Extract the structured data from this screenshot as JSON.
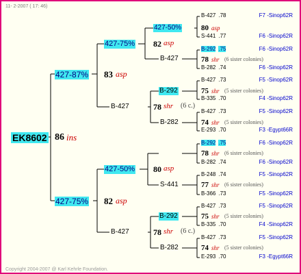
{
  "header": {
    "text": "11- 2-2007 ( 17: 46)"
  },
  "footer": {
    "text": "Copyright 2004-2007 @ Karl Kehrle Foundation."
  },
  "colors": {
    "border": "#e0007a",
    "highlight": "#40e8f0",
    "link": "#0000cc",
    "race": "#cc0000"
  },
  "root": {
    "id": "EK8602",
    "number": "86",
    "race": "ins"
  },
  "gen1": [
    {
      "id": "427-87%",
      "number": "83",
      "race": "asp",
      "mother": "B-427"
    },
    {
      "id": "427-75%",
      "number": "82",
      "race": "asp",
      "mother": "B-427"
    }
  ],
  "gen2": [
    {
      "id": "427-75%",
      "number": "82",
      "race": "asp",
      "mother": "B-427"
    },
    {
      "id": "B-292",
      "number": "78",
      "race": "shr",
      "colonies": "(6 c.)",
      "mother": "B-282"
    },
    {
      "id": "427-50%",
      "number": "80",
      "race": "asp",
      "mother": "S-441"
    },
    {
      "id": "B-292",
      "number": "78",
      "race": "shr",
      "colonies": "(6 c.)",
      "mother": "B-282"
    }
  ],
  "gen3": [
    {
      "id": "427-50%",
      "number": "80",
      "race": "asp",
      "mother": "S-441"
    },
    {
      "id": "B-427"
    },
    {
      "id": "B-292",
      "number": "78",
      "race": "shr",
      "colonies": "(6 sister colonies)",
      "mother": "B-282"
    },
    {
      "id": "B-427",
      "number": "75",
      "race": "shr",
      "colonies": "(5 sister colonies)",
      "mother": "B-335"
    },
    {
      "id": "B-427",
      "number": "74",
      "race": "shr",
      "colonies": "(5 sister colonies)",
      "mother": "E-293"
    },
    {
      "id": "B-292",
      "number": "78",
      "race": "shr",
      "colonies": "(6 sister colonies)",
      "mother": "B-282"
    },
    {
      "id": "B-248",
      "number": "77",
      "race": "shr",
      "colonies": "(6 sister colonies)",
      "mother": "B-366"
    },
    {
      "id": "B-427",
      "number": "75",
      "race": "shr",
      "colonies": "(5 sister colonies)",
      "mother": "B-335"
    },
    {
      "id": "B-427",
      "number": "74",
      "race": "shr",
      "colonies": "(5 sister colonies)",
      "mother": "E-293"
    }
  ],
  "leaves": [
    {
      "id": "B-427",
      "score": ".78",
      "loc": "F7 -Sinop62R"
    },
    {
      "id": "S-441",
      "score": ".77",
      "loc": "F6 -Sinop62R"
    },
    {
      "id": "B-292",
      "score": ".75",
      "loc": "F6 -Sinop62R"
    },
    {
      "id": "B-282",
      "score": ".74",
      "loc": "F6 -Sinop62R"
    },
    {
      "id": "B-427",
      "score": ".73",
      "loc": "F5 -Sinop62R"
    },
    {
      "id": "B-335",
      "score": ".70",
      "loc": "F4 -Sinop62R"
    },
    {
      "id": "B-427",
      "score": ".73",
      "loc": "F5 -Sinop62R"
    },
    {
      "id": "E-293",
      "score": ".70",
      "loc": "F3 -Egypt66R"
    },
    {
      "id": "B-292",
      "score": ".75",
      "loc": "F6 -Sinop62R"
    },
    {
      "id": "B-282",
      "score": ".74",
      "loc": "F6 -Sinop62R"
    },
    {
      "id": "B-248",
      "score": ".74",
      "loc": "F5 -Sinop62R"
    },
    {
      "id": "B-366",
      "score": ".73",
      "loc": "F5 -Sinop62R"
    },
    {
      "id": "B-427",
      "score": ".73",
      "loc": "F5 -Sinop62R"
    },
    {
      "id": "B-335",
      "score": ".70",
      "loc": "F4 -Sinop62R"
    },
    {
      "id": "B-427",
      "score": ".73",
      "loc": "F5 -Sinop62R"
    },
    {
      "id": "E-293",
      "score": ".70",
      "loc": "F3 -Egypt66R"
    }
  ]
}
